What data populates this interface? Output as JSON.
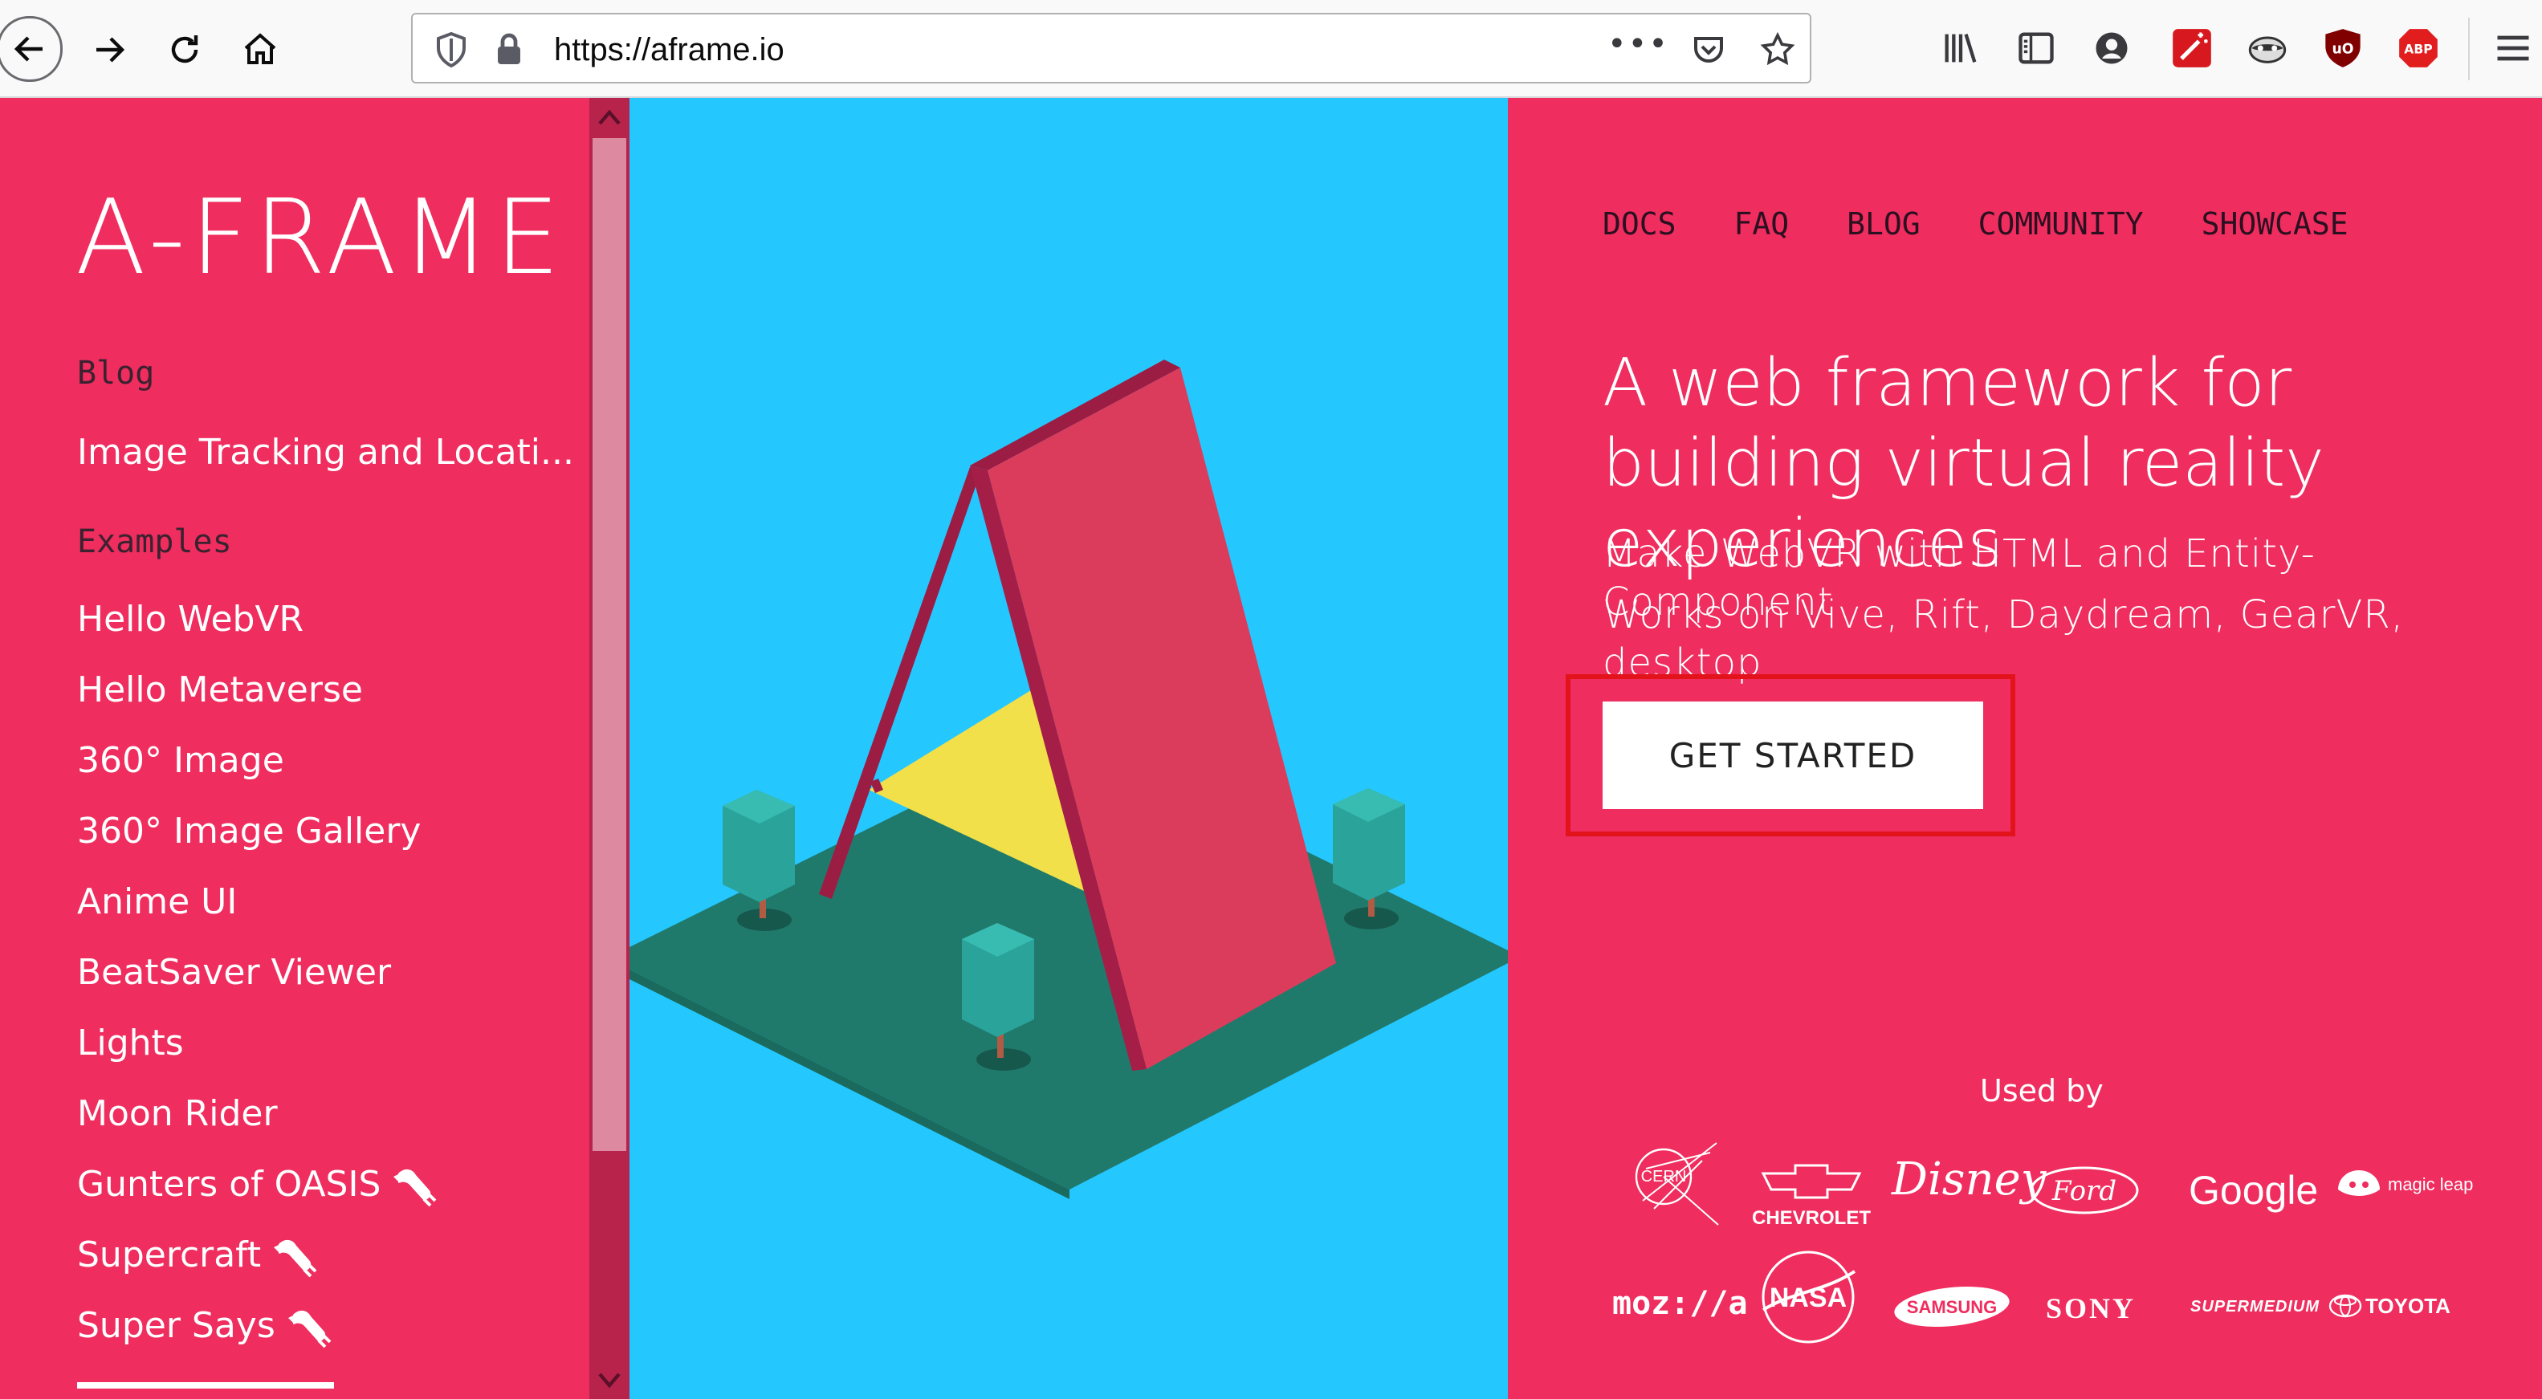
{
  "browser": {
    "url": "https://aframe.io",
    "more_label": "•••"
  },
  "site": {
    "logo": "A-FRAME",
    "sidebar": {
      "sections": [
        {
          "title": "Blog",
          "links": [
            "Image Tracking and Locati..."
          ]
        },
        {
          "title": "Examples",
          "links": [
            "Hello WebVR",
            "Hello Metaverse",
            "360° Image",
            "360° Image Gallery",
            "Anime UI",
            "BeatSaver Viewer",
            "Lights",
            "Moon Rider",
            "Gunters of OASIS",
            "Supercraft",
            "Super Says"
          ]
        }
      ]
    },
    "nav": [
      "DOCS",
      "FAQ",
      "BLOG",
      "COMMUNITY",
      "SHOWCASE"
    ],
    "headline": "A web framework for building virtual reality experiences",
    "sub1": "Make WebVR with HTML and Entity-Component",
    "sub2": "Works on Vive, Rift, Daydream, GearVR, desktop",
    "cta": "GET STARTED",
    "used_by_label": "Used by",
    "brands": [
      "CERN",
      "CHEVROLET",
      "Disney",
      "Ford",
      "Google",
      "magic leap",
      "moz://a",
      "NASA",
      "SAMSUNG",
      "SONY",
      "SUPERMEDIUM",
      "TOYOTA"
    ]
  },
  "colors": {
    "brand_pink": "#ef2d5e",
    "hero_blue": "#25c7ff",
    "highlight_red": "#e3131b"
  }
}
